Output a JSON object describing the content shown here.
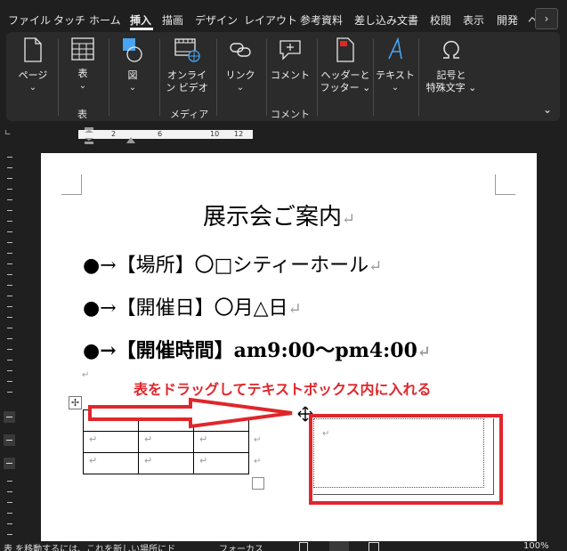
{
  "tabs": [
    "ファイル",
    "タッチ",
    "ホーム",
    "挿入",
    "描画",
    "デザイン",
    "レイアウト",
    "参考資料",
    "差し込み文書",
    "校閲",
    "表示",
    "開発",
    "ヘ"
  ],
  "tab_scroll_glyph": "›",
  "ribbon": {
    "page": {
      "label": "ページ",
      "chevron": "⌄"
    },
    "table": {
      "label": "表",
      "chevron": "⌄",
      "group": "表"
    },
    "figure": {
      "label": "図",
      "chevron": "⌄"
    },
    "online_video": {
      "line1": "オンライ",
      "line2": "ン ビデオ",
      "group": "メディア"
    },
    "link": {
      "label": "リンク",
      "chevron": "⌄"
    },
    "comment": {
      "label": "コメント",
      "group": "コメント"
    },
    "header_footer": {
      "line1": "ヘッダーと",
      "line2": "フッター ⌄"
    },
    "text": {
      "label": "テキスト",
      "chevron": "⌄"
    },
    "symbol": {
      "line1": "記号と",
      "line2": "特殊文字 ⌄"
    },
    "collapse_glyph": "⌄"
  },
  "ruler": {
    "ticks": [
      "2",
      "6",
      "10",
      "12"
    ]
  },
  "document": {
    "title": "展示会ご案内",
    "lines": [
      "●→【場所】〇□シティーホール",
      "●→【開催日】〇月△日",
      "●→【開催時間】am9:00〜pm4:00"
    ],
    "paragraph_mark": "↵",
    "annotation": "表をドラッグしてテキストボックス内に入れる",
    "table_cell_mark": "↵",
    "table_rows": 3,
    "table_cols": 3
  },
  "status_bar": {
    "hint": "表 を移動するには、これを新しい場所にド",
    "focus": "フォーカス",
    "zoom": "100%"
  },
  "colors": {
    "annotation_red": "#e0262b",
    "ribbon_bg": "#2b2b2b",
    "accent_blue": "#4aa3f0"
  }
}
